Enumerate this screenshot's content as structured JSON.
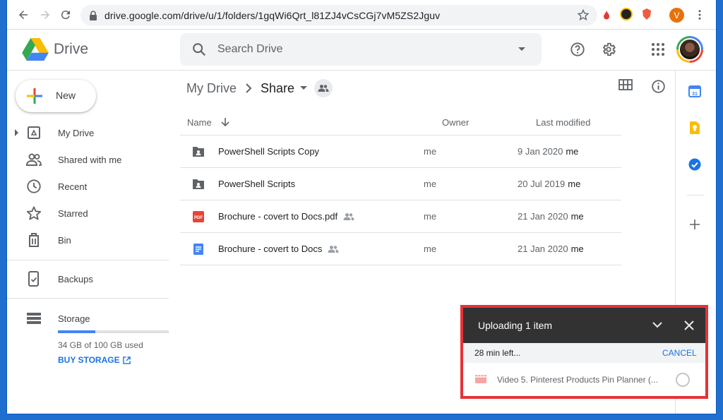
{
  "browser": {
    "url": "drive.google.com/drive/u/1/folders/1gqWi6Qrt_l81ZJ4vCsCGj7vM5ZS2Jguv",
    "profile_initial": "V"
  },
  "header": {
    "brand": "Drive",
    "search_placeholder": "Search Drive"
  },
  "sidebar": {
    "new_label": "New",
    "items": [
      {
        "label": "My Drive",
        "icon": "my-drive-icon"
      },
      {
        "label": "Shared with me",
        "icon": "people-icon"
      },
      {
        "label": "Recent",
        "icon": "clock-icon"
      },
      {
        "label": "Starred",
        "icon": "star-icon"
      },
      {
        "label": "Bin",
        "icon": "trash-icon"
      },
      {
        "label": "Backups",
        "icon": "backup-phone-icon"
      },
      {
        "label": "Storage",
        "icon": "storage-icon"
      }
    ],
    "storage": {
      "used_text": "34 GB of 100 GB used",
      "used_fraction": 0.34,
      "buy_label": "BUY STORAGE"
    }
  },
  "main": {
    "breadcrumb": {
      "root": "My Drive",
      "current": "Share"
    },
    "columns": {
      "name": "Name",
      "owner": "Owner",
      "modified": "Last modified"
    },
    "files": [
      {
        "name": "PowerShell Scripts Copy",
        "type": "shared-folder",
        "shared": false,
        "owner": "me",
        "modified": "9 Jan 2020",
        "by": "me"
      },
      {
        "name": "PowerShell Scripts",
        "type": "shared-folder",
        "shared": false,
        "owner": "me",
        "modified": "20 Jul 2019",
        "by": "me"
      },
      {
        "name": "Brochure - covert to Docs.pdf",
        "type": "pdf",
        "shared": true,
        "owner": "me",
        "modified": "21 Jan 2020",
        "by": "me"
      },
      {
        "name": "Brochure - covert to Docs",
        "type": "doc",
        "shared": true,
        "owner": "me",
        "modified": "21 Jan 2020",
        "by": "me"
      }
    ]
  },
  "upload": {
    "title": "Uploading 1 item",
    "time_left": "28 min left...",
    "cancel_label": "CANCEL",
    "file_name": "Video 5. Pinterest Products Pin Planner (...",
    "highlight_color": "#e53238"
  },
  "colors": {
    "accent": "#1a73e8",
    "upload_header": "#323232"
  }
}
